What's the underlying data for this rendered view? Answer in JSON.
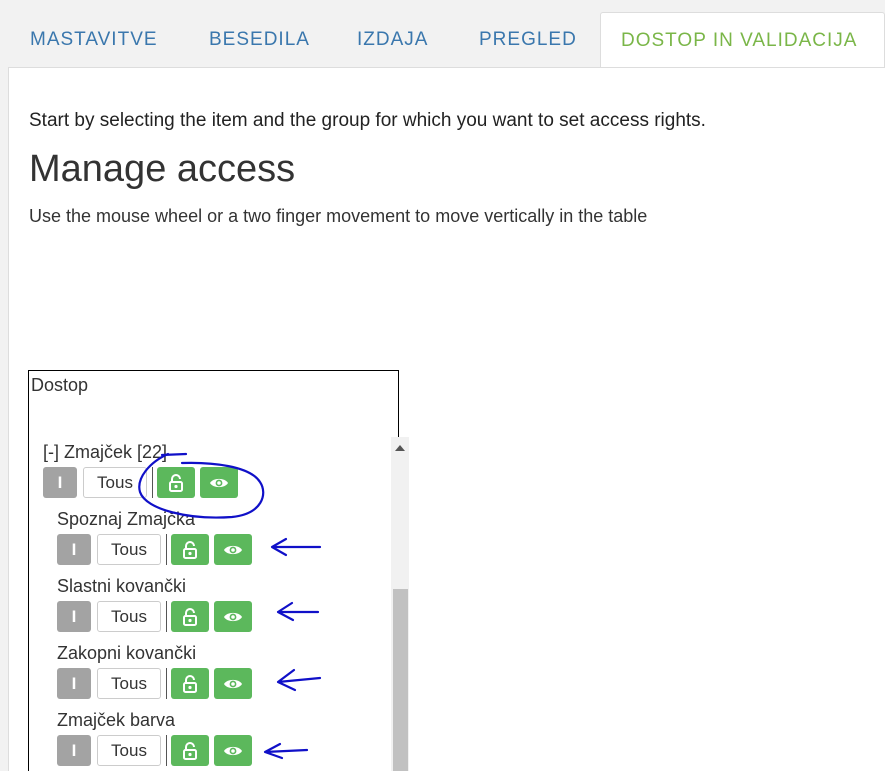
{
  "tabs": [
    {
      "label": "MASTAVITVE",
      "active": false
    },
    {
      "label": "BESEDILA",
      "active": false
    },
    {
      "label": "IZDAJA",
      "active": false
    },
    {
      "label": "PREGLED",
      "active": false
    },
    {
      "label": "DOSTOP IN VALIDACIJA",
      "active": true
    }
  ],
  "intro": "Start by selecting the item and the group for which you want to set access rights.",
  "title": "Manage access",
  "hint": "Use the mouse wheel or a two finger movement to move vertically in the table",
  "table": {
    "header": "Dostop",
    "rows": [
      {
        "label": "[-] Zmajček [22]",
        "i_label": "I",
        "tous_label": "Tous",
        "lock_icon": "unlock-icon",
        "eye_icon": "eye-icon"
      },
      {
        "label": "Spoznaj Zmajčka",
        "i_label": "I",
        "tous_label": "Tous",
        "lock_icon": "unlock-icon",
        "eye_icon": "eye-icon"
      },
      {
        "label": "Slastni kovančki",
        "i_label": "I",
        "tous_label": "Tous",
        "lock_icon": "unlock-icon",
        "eye_icon": "eye-icon"
      },
      {
        "label": "Zakopni kovančki",
        "i_label": "I",
        "tous_label": "Tous",
        "lock_icon": "unlock-icon",
        "eye_icon": "eye-icon"
      },
      {
        "label": "Zmajček barva",
        "i_label": "I",
        "tous_label": "Tous",
        "lock_icon": "unlock-icon",
        "eye_icon": "eye-icon"
      }
    ]
  },
  "colors": {
    "tab_text": "#3a77ad",
    "tab_active_text": "#7ab648",
    "green_button": "#5cb85c",
    "gray_button": "#a3a3a3",
    "annotation": "#1010c8"
  }
}
